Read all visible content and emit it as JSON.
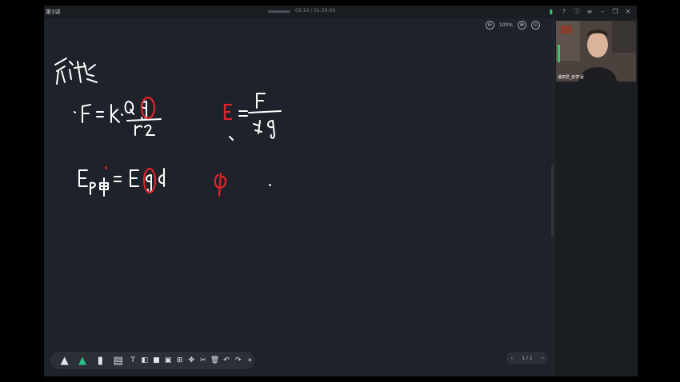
{
  "window": {
    "title": "第3讲",
    "time": "05:10 / 01:30:00",
    "controls": [
      "signal-icon",
      "help-icon",
      "info-icon",
      "menu-icon",
      "minimize-icon",
      "restore-icon",
      "close-icon"
    ]
  },
  "zoom": {
    "minus": "⊖",
    "level": "100%",
    "plus": "⊕",
    "fit": "⊙"
  },
  "video": {
    "label": "潘丽君_欧梦涵"
  },
  "toolbar": {
    "tools": [
      "pen-cone-icon",
      "highlighter-icon",
      "bucket-icon",
      "sticky-note-icon",
      "text-icon",
      "shape-icon",
      "square-icon",
      "image-icon",
      "grid-icon",
      "move-icon",
      "scissors-icon",
      "trash-icon",
      "undo-icon",
      "redo-icon",
      "collapse-icon"
    ]
  },
  "pager": {
    "prev": "‹",
    "page": "1 / 1",
    "next": "›"
  },
  "colors": {
    "ink": "#ffffff",
    "red": "#e0242a",
    "board": "#1e222a"
  }
}
